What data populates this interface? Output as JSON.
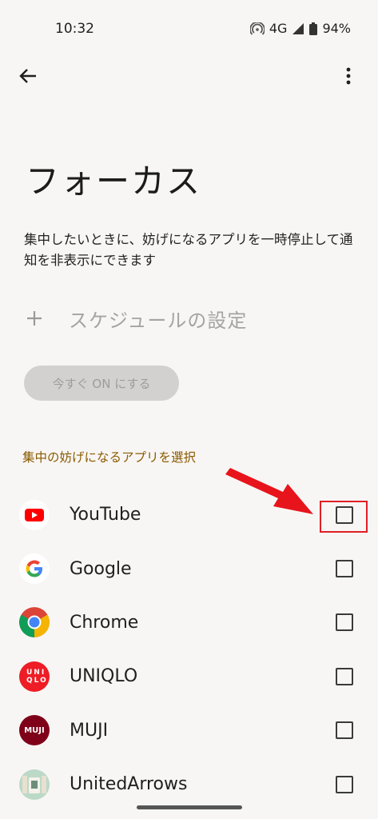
{
  "status_bar": {
    "time": "10:32",
    "network": "4G",
    "battery": "94%"
  },
  "header": {
    "back_icon": "arrow-left-icon",
    "more_icon": "more-vert-icon"
  },
  "page": {
    "title": "フォーカス",
    "description": "集中したいときに、妨げになるアプリを一時停止して通知を非表示にできます",
    "schedule_label": "スケジュールの設定",
    "on_button_label": "今すぐ ON にする",
    "section_header": "集中の妨げになるアプリを選択"
  },
  "apps": [
    {
      "label": "YouTube",
      "icon": "youtube-icon",
      "checked": false
    },
    {
      "label": "Google",
      "icon": "google-icon",
      "checked": false
    },
    {
      "label": "Chrome",
      "icon": "chrome-icon",
      "checked": false
    },
    {
      "label": "UNIQLO",
      "icon": "uniqlo-icon",
      "checked": false,
      "icon_text": "UNI QLO"
    },
    {
      "label": "MUJI",
      "icon": "muji-icon",
      "checked": false,
      "icon_text": "MUJI"
    },
    {
      "label": "UnitedArrows",
      "icon": "united-arrows-icon",
      "checked": false
    }
  ],
  "colors": {
    "background": "#f8f6f4",
    "accent_section": "#8a5a00",
    "annotation_red": "#e01e25"
  }
}
